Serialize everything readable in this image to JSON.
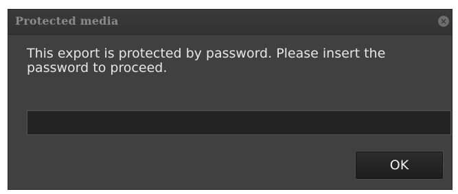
{
  "dialog": {
    "title": "Protected media",
    "close_icon": "close-icon",
    "message": "This export is protected by password. Please insert the password to proceed.",
    "password_field": {
      "value": "",
      "placeholder": ""
    },
    "ok_label": "OK"
  },
  "colors": {
    "dialog_bg": "#404040",
    "title_text": "#8a8a8a",
    "body_text": "#e6e6e6",
    "input_bg": "#232323",
    "button_bg": "#1e1e1e"
  }
}
